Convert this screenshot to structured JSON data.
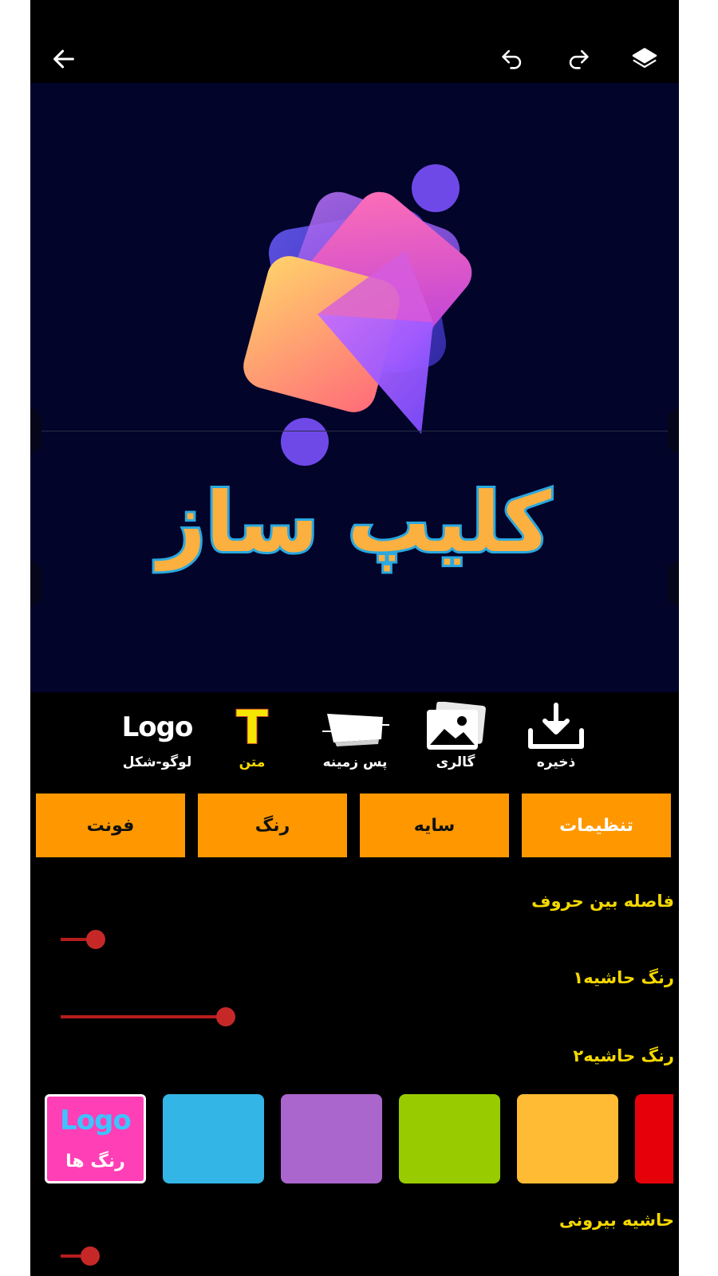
{
  "canvas": {
    "title_text": "کلیپ ساز",
    "background_color": "#02042a"
  },
  "topbar": {
    "back_icon": "arrow-left-icon",
    "undo_icon": "undo-icon",
    "redo_icon": "redo-icon",
    "layers_icon": "layers-icon"
  },
  "tools": {
    "save_label": "ذخیره",
    "gallery_label": "گالری",
    "background_label": "پس زمینه",
    "text_label": "متن",
    "logo_label": "لوگو-شکل",
    "logo_mark_text": "Logo",
    "text_tool_glyph": "T"
  },
  "tabs": {
    "settings": "تنظیمات",
    "shadow": "سایه",
    "color": "رنگ",
    "font": "فونت"
  },
  "settings": {
    "letter_spacing_label": "فاصله بین حروف",
    "letter_spacing_value": 0.19,
    "border_color1_label": "رنگ حاشیه۱",
    "border_color1_value": 0.9,
    "border_color2_label": "رنگ حاشیه۲",
    "outer_border_label": "حاشیه بیرونی",
    "outer_border_value": 0.16
  },
  "swatches": {
    "logo_swatch_label": "رنگ ها",
    "logo_swatch_mark": "Logo",
    "colors": [
      "#ffbb33",
      "#99cc00",
      "#aa66cc",
      "#33b5e5",
      "#e6000a"
    ]
  },
  "theme": {
    "accent": "#ff9800",
    "label_color": "#f5d800",
    "slider_color": "#c62828"
  }
}
